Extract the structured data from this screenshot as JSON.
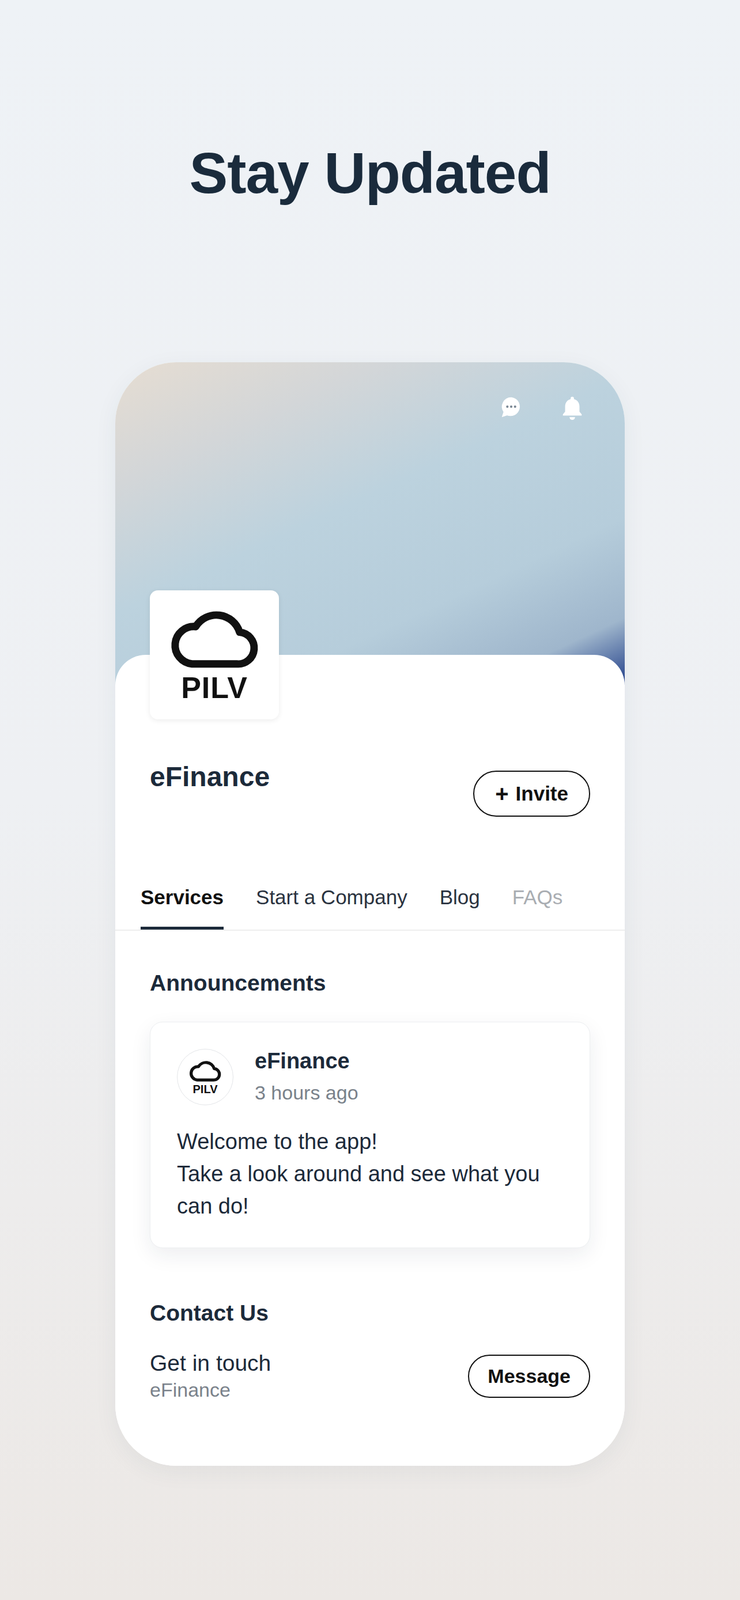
{
  "page": {
    "title": "Stay Updated"
  },
  "profile": {
    "logo_text": "PILV",
    "name": "eFinance",
    "invite_button": {
      "icon": "+",
      "label": "Invite"
    }
  },
  "tabs": [
    {
      "label": "Services",
      "selected": true,
      "dimmed": false
    },
    {
      "label": "Start a Company",
      "selected": false,
      "dimmed": false
    },
    {
      "label": "Blog",
      "selected": false,
      "dimmed": false
    },
    {
      "label": "FAQs",
      "selected": false,
      "dimmed": true
    }
  ],
  "announcements": {
    "title": "Announcements",
    "posts": [
      {
        "author": "eFinance",
        "avatar_text": "PILV",
        "time": "3 hours ago",
        "lines": [
          "Welcome to the app!",
          "Take a look around and see what you can do!"
        ]
      }
    ]
  },
  "contact": {
    "title": "Contact Us",
    "line": "Get in touch",
    "sub": "eFinance",
    "button": "Message"
  }
}
